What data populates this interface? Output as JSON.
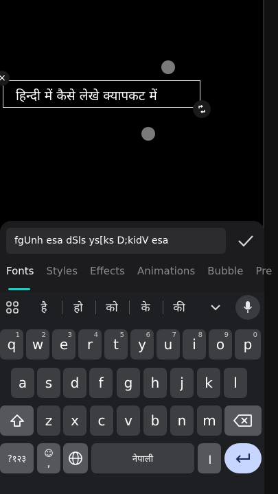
{
  "canvas": {
    "text_overlay": "हिन्दी में कैसे लेखे क्यापकट में"
  },
  "editor": {
    "input_value": "fgUnh esa dSls ys[ks D;kidV esa",
    "tabs": [
      "Fonts",
      "Styles",
      "Effects",
      "Animations",
      "Bubble",
      "Pre"
    ],
    "active_tab": "Fonts",
    "accent_color": "#2ec7c0"
  },
  "keyboard": {
    "suggestions": [
      "है",
      "हो",
      "को",
      "के",
      "की"
    ],
    "row1": [
      {
        "k": "q",
        "s": "1"
      },
      {
        "k": "w",
        "s": "2"
      },
      {
        "k": "e",
        "s": "3"
      },
      {
        "k": "r",
        "s": "4"
      },
      {
        "k": "t",
        "s": "5"
      },
      {
        "k": "y",
        "s": "6"
      },
      {
        "k": "u",
        "s": "7"
      },
      {
        "k": "i",
        "s": "8"
      },
      {
        "k": "o",
        "s": "9"
      },
      {
        "k": "p",
        "s": "0"
      }
    ],
    "row2": [
      "a",
      "s",
      "d",
      "f",
      "g",
      "h",
      "j",
      "k",
      "l"
    ],
    "row3": [
      "z",
      "x",
      "c",
      "v",
      "b",
      "n",
      "m"
    ],
    "symbols_label": "?१२३",
    "emoji_comma": ",",
    "space_label": "नेपाली",
    "danda_label": "।"
  }
}
